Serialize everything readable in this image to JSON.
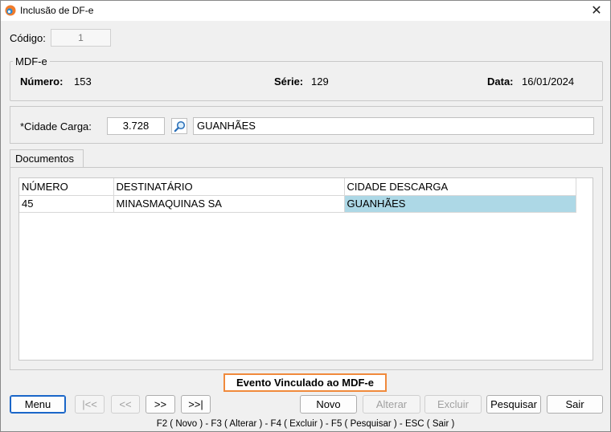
{
  "window": {
    "title": "Inclusão de DF-e",
    "close_icon": "close-icon"
  },
  "codigo": {
    "label": "Código:",
    "value": "1"
  },
  "mdfe": {
    "legend": "MDF-e",
    "numero_label": "Número:",
    "numero_value": "153",
    "serie_label": "Série:",
    "serie_value": "129",
    "data_label": "Data:",
    "data_value": "16/01/2024"
  },
  "cidade_carga": {
    "label": "*Cidade Carga:",
    "code": "3.728",
    "name": "GUANHÃES",
    "search_icon": "magnifier-icon"
  },
  "tabs": {
    "documentos": "Documentos"
  },
  "grid": {
    "columns": [
      "NÚMERO",
      "DESTINATÁRIO",
      "CIDADE DESCARGA"
    ],
    "rows": [
      [
        "45",
        "MINASMAQUINAS SA",
        "GUANHÃES"
      ]
    ],
    "selected_color": "#add8e6"
  },
  "evento": {
    "label": "Evento Vinculado ao MDF-e",
    "border_color": "#f08a3c"
  },
  "buttons": {
    "menu": "Menu",
    "first": "|<<",
    "prev": "<<",
    "next": ">>",
    "last": ">>|",
    "novo": "Novo",
    "alterar": "Alterar",
    "excluir": "Excluir",
    "pesquisar": "Pesquisar",
    "sair": "Sair"
  },
  "footer": {
    "shortcuts": "F2 ( Novo )  -  F3 ( Alterar )  -  F4 ( Excluir )  -  F5 ( Pesquisar )  -  ESC ( Sair )"
  }
}
